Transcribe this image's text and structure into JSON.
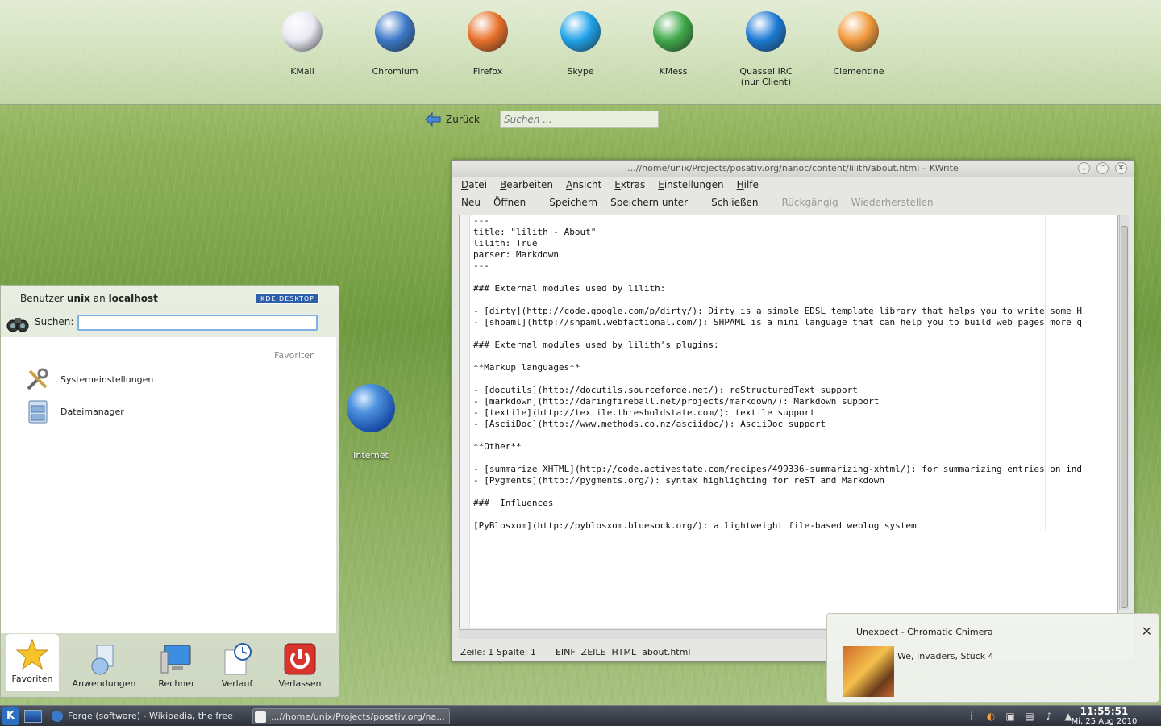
{
  "launchers": [
    {
      "label": "KMail",
      "icon": "kmail-icon",
      "color": "#e8e8f2"
    },
    {
      "label": "Chromium",
      "icon": "chromium-icon",
      "color": "#3b78c8"
    },
    {
      "label": "Firefox",
      "icon": "firefox-icon",
      "color": "#e8702a"
    },
    {
      "label": "Skype",
      "icon": "skype-icon",
      "color": "#1ea1e8"
    },
    {
      "label": "KMess",
      "icon": "kmess-icon",
      "color": "#3fa84a"
    },
    {
      "label": "Quassel IRC\n(nur Client)",
      "icon": "quassel-icon",
      "color": "#1a7ad4"
    },
    {
      "label": "Clementine",
      "icon": "clementine-icon",
      "color": "#f29a3c"
    }
  ],
  "nav": {
    "back_label": "Zurück",
    "search_placeholder": "Suchen ..."
  },
  "desktop": {
    "internet_label": "Internet"
  },
  "kickoff": {
    "user_prefix": "Benutzer",
    "user": "unix",
    "host_prefix": "an",
    "host": "localhost",
    "badge": "KDE DESKTOP",
    "search_label": "Suchen:",
    "section": "Favoriten",
    "items": [
      "Systemeinstellungen",
      "Dateimanager"
    ],
    "tabs": [
      "Favoriten",
      "Anwendungen",
      "Rechner",
      "Verlauf",
      "Verlassen"
    ]
  },
  "kwrite": {
    "title": "...//home/unix/Projects/posativ.org/nanoc/content/lilith/about.html – KWrite",
    "menu": [
      "Datei",
      "Bearbeiten",
      "Ansicht",
      "Extras",
      "Einstellungen",
      "Hilfe"
    ],
    "toolbar": [
      "Neu",
      "Öffnen",
      "Speichern",
      "Speichern unter",
      "Schließen",
      "Rückgängig",
      "Wiederherstellen"
    ],
    "lines": [
      "---",
      "title: \"lilith - About\"",
      "lilith: True",
      "parser: Markdown",
      "---",
      "",
      "### External modules used by lilith:",
      "",
      "- [dirty](http://code.google.com/p/dirty/): Dirty is a simple EDSL template library that helps you to write some H",
      "- [shpaml](http://shpaml.webfactional.com/): SHPAML is a mini language that can help you to build web pages more q",
      "",
      "### External modules used by lilith's plugins:",
      "",
      "**Markup languages**",
      "",
      "- [docutils](http://docutils.sourceforge.net/): reStructuredText support",
      "- [markdown](http://daringfireball.net/projects/markdown/): Markdown support",
      "- [textile](http://textile.thresholdstate.com/): textile support",
      "- [AsciiDoc](http://www.methods.co.nz/asciidoc/): AsciiDoc support",
      "",
      "**Other**",
      "",
      "- [summarize XHTML](http://code.activestate.com/recipes/499336-summarizing-xhtml/): for summarizing entries on ind",
      "- [Pygments](http://pygments.org/): syntax highlighting for reST and Markdown",
      "",
      "###  Influences",
      "",
      "[PyBlosxom](http://pyblosxom.bluesock.org/): a lightweight file-based weblog system"
    ],
    "status": {
      "pos": "Zeile: 1 Spalte: 1",
      "mode": "EINF  ZEILE  HTML  about.html"
    }
  },
  "notification": {
    "artist_title": "Unexpect - Chromatic Chimera",
    "album": "We, Invaders, Stück 4"
  },
  "taskbar": {
    "tasks": [
      "Forge (software) - Wikipedia, the free",
      "...//home/unix/Projects/posativ.org/na..."
    ],
    "time": "11:55:51",
    "date": "Mi, 25 Aug 2010"
  }
}
